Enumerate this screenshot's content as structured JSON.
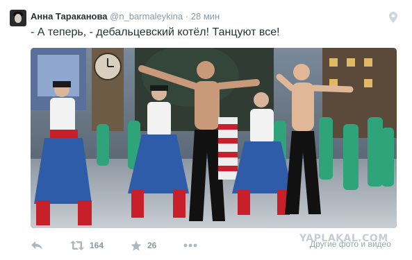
{
  "tweet": {
    "author_name": "Анна Тараканова",
    "handle": "@n_barmaleykina",
    "separator": "·",
    "time": "28 мин",
    "text": "- А теперь, - дебальцевский котёл! Танцуют все!"
  },
  "icons": {
    "avatar": "user-avatar",
    "location": "location-pin-icon",
    "reply": "reply-icon",
    "retweet": "retweet-icon",
    "like": "star-icon",
    "more": "more-dots-icon"
  },
  "actions": {
    "retweets": "164",
    "favorites": "26"
  },
  "watermark": {
    "site": "YAPLAKAL.COM",
    "caption": "Другие фото и видео"
  },
  "colors": {
    "text": "#292f33",
    "meta": "#8899a6",
    "icon": "#aab8c2"
  }
}
